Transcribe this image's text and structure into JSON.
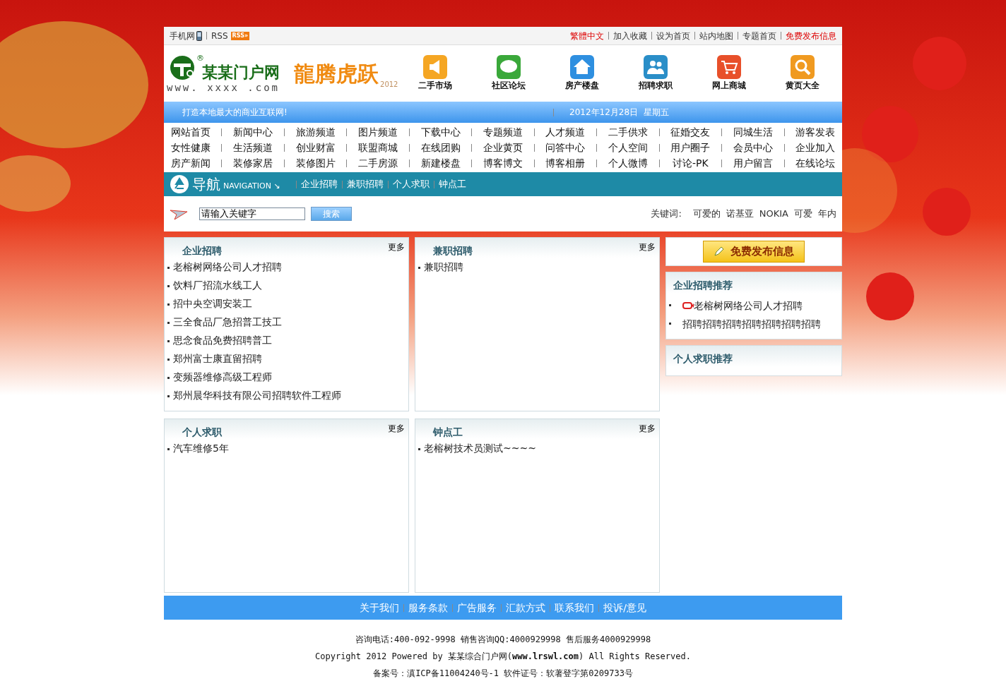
{
  "top_bar": {
    "mobile": "手机网",
    "rss": "RSS",
    "rss_badge": "RSS»",
    "links": [
      {
        "label": "繁體中文",
        "highlight": true
      },
      {
        "label": "加入收藏",
        "highlight": false
      },
      {
        "label": "设为首页",
        "highlight": false
      },
      {
        "label": "站内地图",
        "highlight": false
      },
      {
        "label": "专题首页",
        "highlight": false
      },
      {
        "label": "免费发布信息",
        "highlight": true
      }
    ]
  },
  "header": {
    "logo_mark": "®",
    "logo_name": "某某门户网",
    "logo_url": "www. xxxx .com",
    "banner_title": "龍腾虎跃",
    "banner_year": "2012",
    "shortcuts": [
      {
        "label": "二手市场",
        "kind": "megaphone"
      },
      {
        "label": "社区论坛",
        "kind": "chat"
      },
      {
        "label": "房产楼盘",
        "kind": "house"
      },
      {
        "label": "招聘求职",
        "kind": "people"
      },
      {
        "label": "网上商城",
        "kind": "cart"
      },
      {
        "label": "黄页大全",
        "kind": "magnifier"
      }
    ]
  },
  "info_bar": {
    "slogan": "打造本地最大的商业互联网!",
    "date": "2012年12月28日  星期五"
  },
  "channels": [
    [
      "网站首页",
      "新闻中心",
      "旅游频道",
      "图片频道",
      "下载中心",
      "专题频道",
      "人才频道",
      "二手供求",
      "征婚交友",
      "同城生活",
      "游客发表"
    ],
    [
      "女性健康",
      "生活频道",
      "创业财富",
      "联盟商城",
      "在线团购",
      "企业黄页",
      "问答中心",
      "个人空间",
      "用户圈子",
      "会员中心",
      "企业加入"
    ],
    [
      "房产新闻",
      "装修家居",
      "装修图片",
      "二手房源",
      "新建楼盘",
      "博客博文",
      "博客相册",
      "个人微博",
      "讨论-PK",
      "用户留言",
      "在线论坛"
    ]
  ],
  "nav": {
    "title": "导航",
    "subtitle": "NAVIGATION ↘",
    "links": [
      "企业招聘",
      "兼职招聘",
      "个人求职",
      "钟点工"
    ]
  },
  "search": {
    "value": "请输入关键字",
    "button": "搜索",
    "keywords_label": "关键词:",
    "keywords": [
      "可爱的",
      "诺基亚",
      "NOKIA",
      "可爱",
      "年内"
    ]
  },
  "panels": [
    {
      "title": "企业招聘",
      "more": "更多",
      "items": [
        "老榕树网络公司人才招聘",
        "饮料厂招流水线工人",
        "招中央空调安装工",
        "三全食品厂急招普工技工",
        "思念食品免费招聘普工",
        "郑州富士康直留招聘",
        "变频器维修高级工程师",
        "郑州晨华科技有限公司招聘软件工程师"
      ]
    },
    {
      "title": "兼职招聘",
      "more": "更多",
      "items": [
        "兼职招聘"
      ]
    },
    {
      "title": "个人求职",
      "more": "更多",
      "items": [
        "汽车维修5年"
      ]
    },
    {
      "title": "钟点工",
      "more": "更多",
      "items": [
        "老榕树技术员测试~~~~"
      ]
    }
  ],
  "sidebar": {
    "publish_button": "免费发布信息",
    "boxes": [
      {
        "title": "企业招聘推荐",
        "items": [
          {
            "label": "老榕树网络公司人才招聘",
            "hot": true
          },
          {
            "label": "招聘招聘招聘招聘招聘招聘招聘",
            "hot": false
          }
        ]
      },
      {
        "title": "个人求职推荐"
      }
    ]
  },
  "footer": {
    "links": [
      "关于我们",
      "服务条款",
      "广告服务",
      "汇款方式",
      "联系我们",
      "投诉/意见"
    ],
    "lines": [
      "咨询电话:400-092-9998 销售咨询QQ:4000929998 售后服务4000929998",
      "Copyright 2012 Powered by 某某综合门户网(**www.lrswl.com**) All Rights Reserved.",
      "备案号：滇ICP备11004240号-1 软件证号：软著登字第0209733号"
    ]
  }
}
